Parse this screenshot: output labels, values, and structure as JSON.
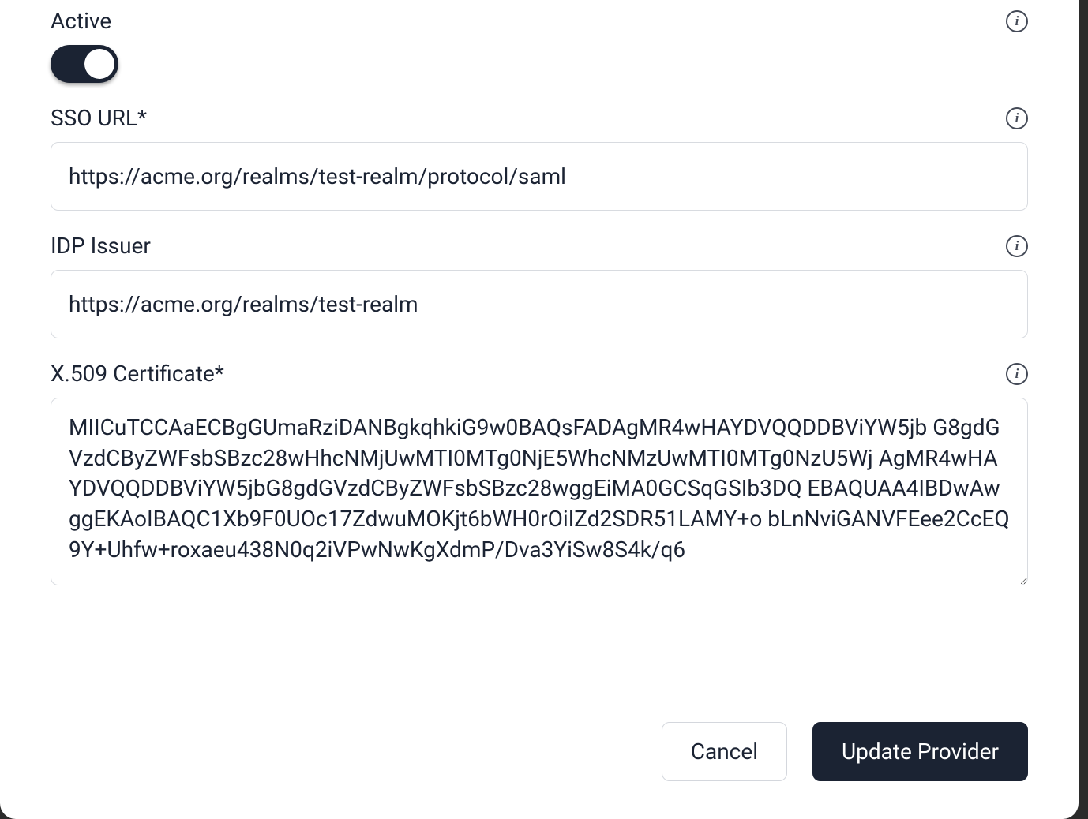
{
  "fields": {
    "active": {
      "label": "Active",
      "value": true
    },
    "sso_url": {
      "label": "SSO URL*",
      "value": "https://acme.org/realms/test-realm/protocol/saml"
    },
    "idp_issuer": {
      "label": "IDP Issuer",
      "value": "https://acme.org/realms/test-realm"
    },
    "x509_certificate": {
      "label": "X.509 Certificate*",
      "value": "MIICuTCCAaECBgGUmaRziDANBgkqhkiG9w0BAQsFADAgMR4wHAYDVQQDDBViYW5jb G8gdGVzdCByZWFsbSBzc28wHhcNMjUwMTI0MTg0NjE5WhcNMzUwMTI0MTg0NzU5Wj AgMR4wHAYDVQQDDBViYW5jbG8gdGVzdCByZWFsbSBzc28wggEiMA0GCSqGSIb3DQ EBAQUAA4IBDwAwggEKAoIBAQC1Xb9F0UOc17ZdwuMOKjt6bWH0rOiIZd2SDR51LAMY+o bLnNviGANVFEee2CcEQ9Y+Uhfw+roxaeu438N0q2iVPwNwKgXdmP/Dva3YiSw8S4k/q6"
    }
  },
  "buttons": {
    "cancel": "Cancel",
    "update": "Update Provider"
  }
}
